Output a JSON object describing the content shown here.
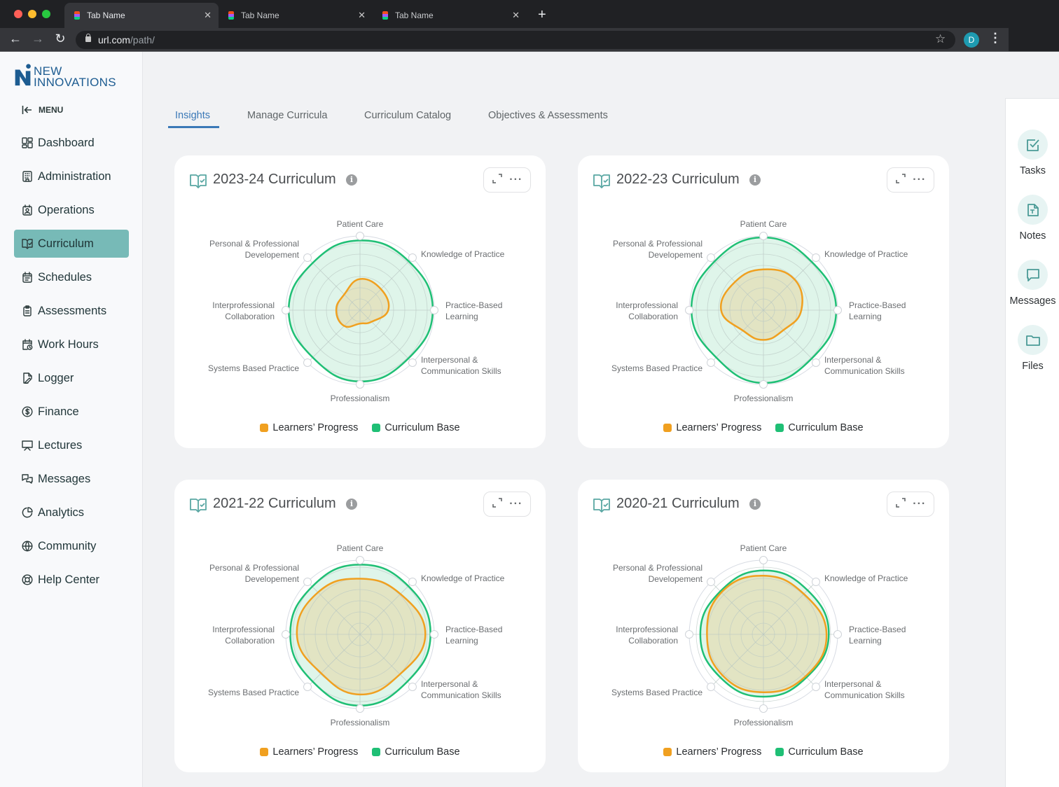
{
  "browser": {
    "tabs": [
      {
        "label": "Tab Name",
        "active": true
      },
      {
        "label": "Tab Name",
        "active": false
      },
      {
        "label": "Tab Name",
        "active": false
      }
    ],
    "url_host": "url.com",
    "url_path": "/path/",
    "profile_initial": "D"
  },
  "brand": {
    "line1": "NEW",
    "line2": "INNOVATIONS"
  },
  "sidebar": {
    "menu_label": "MENU",
    "items": [
      {
        "label": "Dashboard",
        "icon": "dashboard-icon"
      },
      {
        "label": "Administration",
        "icon": "building-icon"
      },
      {
        "label": "Operations",
        "icon": "id-badge-icon"
      },
      {
        "label": "Curriculum",
        "icon": "book-check-icon",
        "active": true
      },
      {
        "label": "Schedules",
        "icon": "calendar-icon"
      },
      {
        "label": "Assessments",
        "icon": "clipboard-icon"
      },
      {
        "label": "Work Hours",
        "icon": "calendar-clock-icon"
      },
      {
        "label": "Logger",
        "icon": "file-edit-icon"
      },
      {
        "label": "Finance",
        "icon": "dollar-circle-icon"
      },
      {
        "label": "Lectures",
        "icon": "presentation-icon"
      },
      {
        "label": "Messages",
        "icon": "chat-bubbles-icon"
      },
      {
        "label": "Analytics",
        "icon": "pie-chart-icon"
      },
      {
        "label": "Community",
        "icon": "globe-icon"
      },
      {
        "label": "Help Center",
        "icon": "lifebuoy-icon"
      }
    ]
  },
  "page_tabs": [
    {
      "label": "Insights",
      "active": true
    },
    {
      "label": "Manage Curricula"
    },
    {
      "label": "Curriculum Catalog"
    },
    {
      "label": "Objectives & Assessments"
    }
  ],
  "right_rail": [
    {
      "label": "Tasks",
      "icon": "checkbox-icon"
    },
    {
      "label": "Notes",
      "icon": "note-icon"
    },
    {
      "label": "Messages",
      "icon": "message-icon"
    },
    {
      "label": "Files",
      "icon": "folder-icon"
    }
  ],
  "legend": {
    "progress": {
      "label": "Learners’ Progress",
      "color": "#f0a020"
    },
    "base": {
      "label": "Curriculum Base",
      "color": "#1fbf75"
    }
  },
  "colors": {
    "accent": "#3b79b7",
    "nav_active": "#77bab7",
    "base_fill": "#dff5ea",
    "progress_fill": "#e2e2bf"
  },
  "chart_data": [
    {
      "type": "radar",
      "title": "2023-24 Curriculum",
      "axes": [
        "Patient Care",
        "Knowledge of Practice",
        "Practice-Based Learning",
        "Interpersonal & Communication Skills",
        "Professionalism",
        "Systems Based Practice",
        "Interprofessional Collaboration",
        "Personal & Professional Developement"
      ],
      "range": [
        0,
        100
      ],
      "rings": 6,
      "series": [
        {
          "name": "Curriculum Base",
          "values": [
            94,
            93,
            98,
            92,
            96,
            90,
            96,
            90
          ]
        },
        {
          "name": "Learners’ Progress",
          "values": [
            42,
            40,
            38,
            22,
            18,
            30,
            32,
            30
          ]
        }
      ],
      "legend": "bottom"
    },
    {
      "type": "radar",
      "title": "2022-23 Curriculum",
      "axes": [
        "Patient Care",
        "Knowledge of Practice",
        "Practice-Based Learning",
        "Interpersonal & Communication Skills",
        "Professionalism",
        "Systems Based Practice",
        "Interprofessional Collaboration",
        "Personal & Professional Developement"
      ],
      "range": [
        0,
        100
      ],
      "rings": 6,
      "series": [
        {
          "name": "Curriculum Base",
          "values": [
            98,
            92,
            98,
            92,
            98,
            90,
            97,
            93
          ]
        },
        {
          "name": "Learners’ Progress",
          "values": [
            55,
            59,
            51,
            38,
            40,
            39,
            57,
            54
          ]
        }
      ],
      "legend": "bottom"
    },
    {
      "type": "radar",
      "title": "2021-22 Curriculum",
      "axes": [
        "Patient Care",
        "Knowledge of Practice",
        "Practice-Based Learning",
        "Interpersonal & Communication Skills",
        "Professionalism",
        "Systems Based Practice",
        "Interprofessional Collaboration",
        "Personal & Professional Developement"
      ],
      "range": [
        0,
        100
      ],
      "rings": 6,
      "series": [
        {
          "name": "Curriculum Base",
          "values": [
            94,
            92,
            95,
            90,
            96,
            90,
            94,
            91
          ]
        },
        {
          "name": "Learners’ Progress",
          "values": [
            75,
            77,
            88,
            76,
            81,
            74,
            85,
            80
          ]
        }
      ],
      "legend": "bottom"
    },
    {
      "type": "radar",
      "title": "2020-21 Curriculum",
      "axes": [
        "Patient Care",
        "Knowledge of Practice",
        "Practice-Based Learning",
        "Interpersonal & Communication Skills",
        "Professionalism",
        "Systems Based Practice",
        "Interprofessional Collaboration",
        "Personal & Professional Developement"
      ],
      "range": [
        0,
        100
      ],
      "rings": 6,
      "series": [
        {
          "name": "Curriculum Base",
          "values": [
            86,
            84,
            88,
            82,
            84,
            82,
            85,
            82
          ]
        },
        {
          "name": "Learners’ Progress",
          "values": [
            79,
            77,
            85,
            80,
            78,
            78,
            76,
            80
          ]
        }
      ],
      "legend": "bottom"
    }
  ],
  "axis_labels": [
    [
      "Patient Care"
    ],
    [
      "Knowledge of Practice"
    ],
    [
      "Practice-Based",
      "Learning"
    ],
    [
      "Interpersonal &",
      "Communication Skills"
    ],
    [
      "Professionalism"
    ],
    [
      "Systems Based Practice"
    ],
    [
      "Interprofessional",
      "Collaboration"
    ],
    [
      "Personal & Professional",
      "Developement"
    ]
  ]
}
